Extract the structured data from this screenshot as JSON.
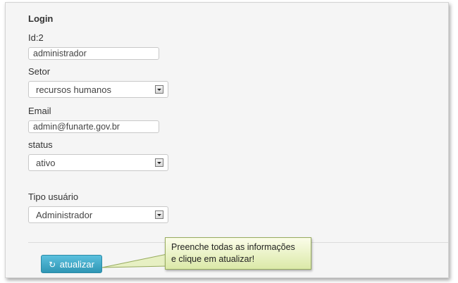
{
  "form": {
    "title": "Login",
    "id_label": "Id:2",
    "login_value": "administrador",
    "setor_label": "Setor",
    "setor_value": "recursos humanos",
    "email_label": "Email",
    "email_value": "admin@funarte.gov.br",
    "status_label": "status",
    "status_value": "ativo",
    "tipo_label": "Tipo usuário",
    "tipo_value": "Administrador"
  },
  "actions": {
    "submit_label": "atualizar",
    "submit_icon": "refresh-icon"
  },
  "callout": {
    "text_line1": "Preenche todas as informações",
    "text_line2": "e clique em atualizar!"
  }
}
